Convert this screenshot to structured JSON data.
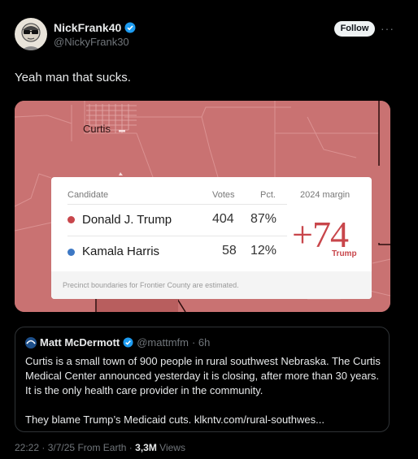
{
  "tweet": {
    "display_name": "NickFrank40",
    "handle": "@NickyFrank30",
    "follow_label": "Follow",
    "text": "Yeah man that sucks."
  },
  "map": {
    "town_label": "Curtis",
    "headers": {
      "candidate": "Candidate",
      "votes": "Votes",
      "pct": "Pct.",
      "margin": "2024 margin"
    },
    "rows": [
      {
        "name": "Donald J. Trump",
        "votes": "404",
        "pct": "87%",
        "color": "#c8464b"
      },
      {
        "name": "Kamala Harris",
        "votes": "58",
        "pct": "12%",
        "color": "#3d78c4"
      }
    ],
    "margin_value": "+74",
    "margin_party": "Trump",
    "note": "Precinct boundaries for Frontier County are estimated."
  },
  "quote": {
    "name": "Matt McDermott",
    "handle": "@mattmfm",
    "time": "· 6h",
    "paragraph1": "Curtis is a small town of 900 people in rural southwest Nebraska. The Curtis Medical Center announced yesterday it is closing, after more than 30 years. It is the only health care provider in the community.",
    "paragraph2": "They blame Trump’s Medicaid cuts. klkntv.com/rural-southwes..."
  },
  "meta": {
    "time": "22:22",
    "date": "3/7/25",
    "source": "From Earth",
    "views_count": "3,3M",
    "views_label": "Views"
  },
  "colors": {
    "background": "#000000",
    "map_fill": "#c97272",
    "trump_red": "#c8464b",
    "harris_blue": "#3d78c4",
    "verified_blue": "#1d9bf0"
  }
}
